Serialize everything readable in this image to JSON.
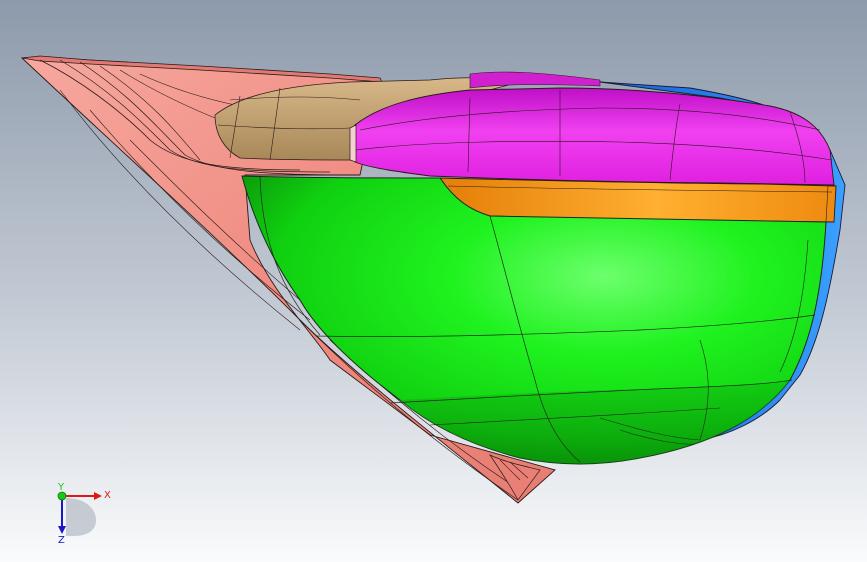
{
  "viewport": {
    "background_top": "#8a98aa",
    "background_bottom": "#f7f8fa"
  },
  "model": {
    "faces": [
      {
        "name": "salmon-flange",
        "color": "#f0938a"
      },
      {
        "name": "tan-fillet",
        "color": "#c8a878"
      },
      {
        "name": "magenta-cap",
        "color": "#e815e8"
      },
      {
        "name": "blue-rim",
        "color": "#1a78e8"
      },
      {
        "name": "orange-band",
        "color": "#f59a10"
      },
      {
        "name": "green-body",
        "color": "#18f018"
      }
    ]
  },
  "triad": {
    "x_label": "X",
    "y_label": "Y",
    "z_label": "Z",
    "x_color": "#e01818",
    "y_color": "#18c818",
    "z_color": "#1818c8"
  }
}
